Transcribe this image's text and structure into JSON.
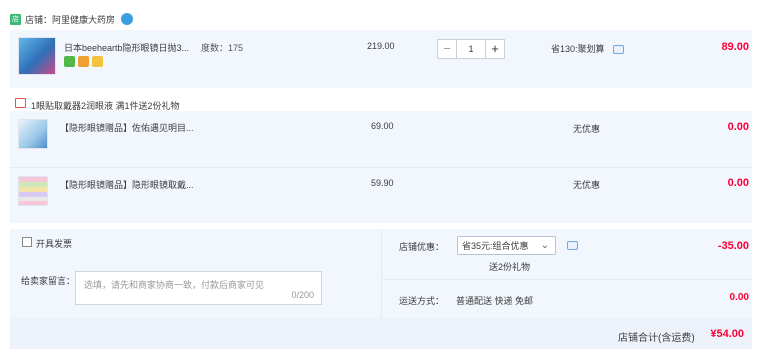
{
  "store": {
    "badge": "店",
    "name_label": "店铺：阿里健康大药房"
  },
  "main_item": {
    "title": "日本beeheartb隐形眼镜日抛3...",
    "degree": "度数：175",
    "unit_price": "219.00",
    "quantity": "1",
    "promo": "省130:聚划算",
    "subtotal": "89.00",
    "tag_colors": [
      "#4fb848",
      "#f0a030",
      "#f3c340"
    ]
  },
  "gift_header": "1眼贴取戴器2润眼液  满1件送2份礼物",
  "gifts": [
    {
      "title": "【隐形眼镜赠品】佐佑遇见明目...",
      "unit_price": "69.00",
      "promo": "无优惠",
      "subtotal": "0.00"
    },
    {
      "title": "【隐形眼镜赠品】隐形眼镜取戴...",
      "unit_price": "59.90",
      "promo": "无优惠",
      "subtotal": "0.00"
    }
  ],
  "invoice": {
    "label": "开具发票"
  },
  "message": {
    "label": "给卖家留言：",
    "placeholder": "选填，请先和商家协商一致，付款后商家可见",
    "counter": "0/200"
  },
  "store_discount": {
    "label": "店铺优惠：",
    "selected": "省35元:组合优惠",
    "note": "送2份礼物",
    "amount": "-35.00"
  },
  "shipping": {
    "label": "运送方式：",
    "method": "普通配送 快递 免邮",
    "amount": "0.00"
  },
  "footer": {
    "label": "店铺合计(含运费)",
    "total": "¥54.00"
  },
  "colors": {
    "accent_red": "#ff0036",
    "panel_bg": "#f2f6fd",
    "store_badge": "#3cb878"
  }
}
